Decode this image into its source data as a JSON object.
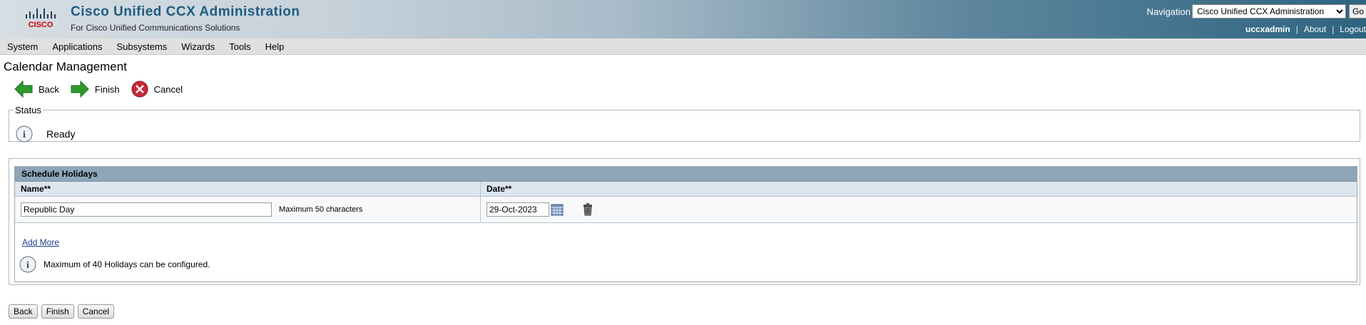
{
  "header": {
    "brand": "CISCO",
    "title": "Cisco Unified CCX Administration",
    "subtitle": "For Cisco Unified Communications Solutions",
    "navigation_label": "Navigation",
    "navigation_selected": "Cisco Unified CCX Administration",
    "go_label": "Go",
    "user": "uccxadmin",
    "about": "About",
    "logout": "Logout"
  },
  "menu": [
    "System",
    "Applications",
    "Subsystems",
    "Wizards",
    "Tools",
    "Help"
  ],
  "page_title": "Calendar Management",
  "toolbar": {
    "back": "Back",
    "finish": "Finish",
    "cancel": "Cancel"
  },
  "status": {
    "legend": "Status",
    "text": "Ready"
  },
  "holidays": {
    "section_title": "Schedule Holidays",
    "name_header": "Name**",
    "date_header": "Date**",
    "rows": [
      {
        "name": "Republic Day",
        "hint": "Maximum 50 characters",
        "date": "29-Oct-2023"
      }
    ],
    "add_more": "Add More",
    "info": "Maximum of 40 Holidays can be configured."
  },
  "bottom": {
    "back": "Back",
    "finish": "Finish",
    "cancel": "Cancel"
  },
  "colors": {
    "brand_blue": "#1f5c80",
    "header_dark": "#2e6480",
    "section_header": "#8ea6b8"
  }
}
